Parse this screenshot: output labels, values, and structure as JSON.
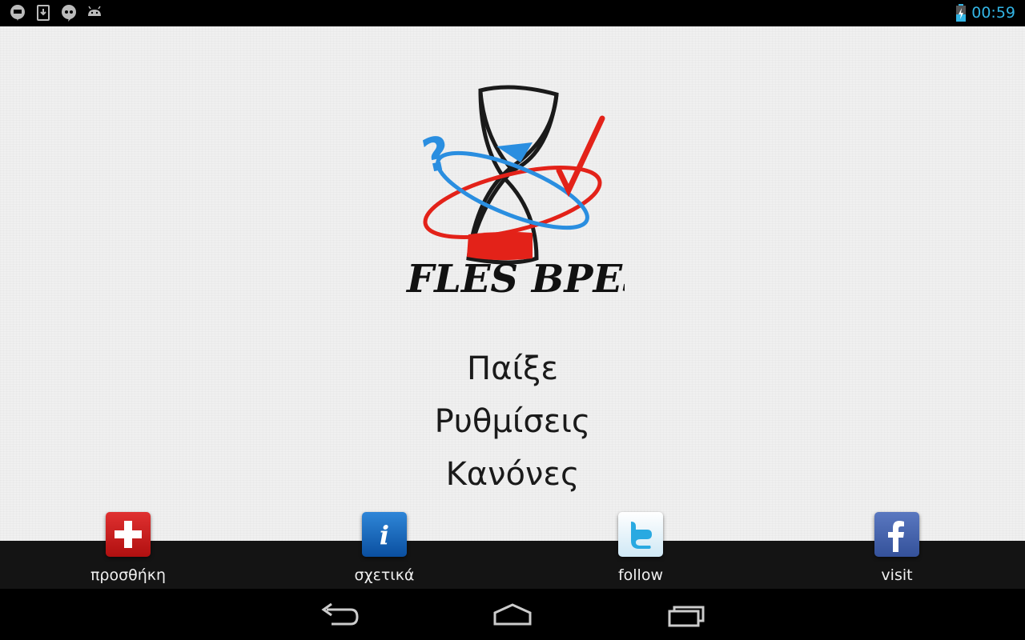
{
  "status_bar": {
    "time": "00:59",
    "icons": [
      "hangouts-icon",
      "download-icon",
      "quote-bubble-icon",
      "android-icon",
      "battery-charging-icon"
    ]
  },
  "app": {
    "logo_text": "FLES BPES!",
    "menu": [
      {
        "label": "Παίξε"
      },
      {
        "label": "Ρυθμίσεις"
      },
      {
        "label": "Κανόνες"
      }
    ]
  },
  "bottom_bar": {
    "actions": [
      {
        "label": "προσθήκη",
        "icon": "add-icon",
        "color": "#c81818"
      },
      {
        "label": "σχετικά",
        "icon": "info-icon",
        "color": "#1565c0"
      },
      {
        "label": "follow",
        "icon": "twitter-icon",
        "color": "#29a9e1"
      },
      {
        "label": "visit",
        "icon": "facebook-icon",
        "color": "#3b5998"
      }
    ]
  },
  "nav_bar": {
    "buttons": [
      "back-icon",
      "home-icon",
      "recents-icon"
    ]
  },
  "colors": {
    "accent": "#33b5e5",
    "background": "#f0f0f0",
    "logo_red": "#e32219",
    "logo_blue": "#2a8ee0"
  }
}
